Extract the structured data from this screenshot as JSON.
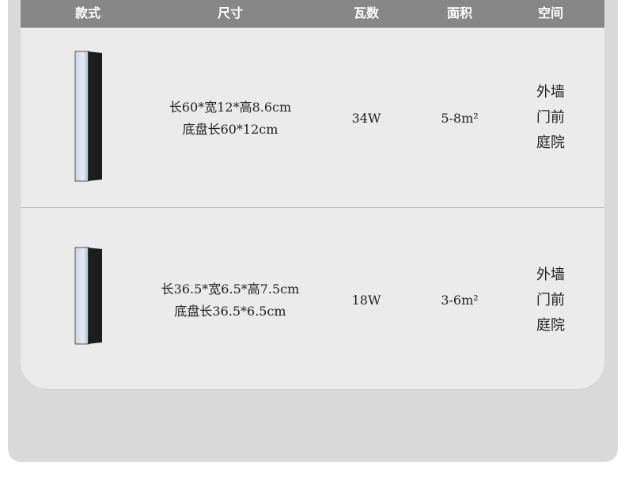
{
  "headers": [
    "款式",
    "尺寸",
    "瓦数",
    "面积",
    "空间"
  ],
  "rows": [
    {
      "size_lines": [
        "长60*宽12*高8.6cm",
        "底盘长60*12cm"
      ],
      "watt": "34W",
      "area": "5-8m²",
      "space_lines": [
        "外墙",
        "门前",
        "庭院"
      ]
    },
    {
      "size_lines": [
        "长36.5*宽6.5*高7.5cm",
        "底盘长36.5*6.5cm"
      ],
      "watt": "18W",
      "area": "3-6m²",
      "space_lines": [
        "外墙",
        "门前",
        "庭院"
      ]
    }
  ],
  "colors": {
    "header_bg": "#878787",
    "card_bg": "#ebebeb",
    "backplate": "#d9d9d9"
  },
  "icons": [
    "wall-lamp-long-image",
    "wall-lamp-short-image"
  ]
}
